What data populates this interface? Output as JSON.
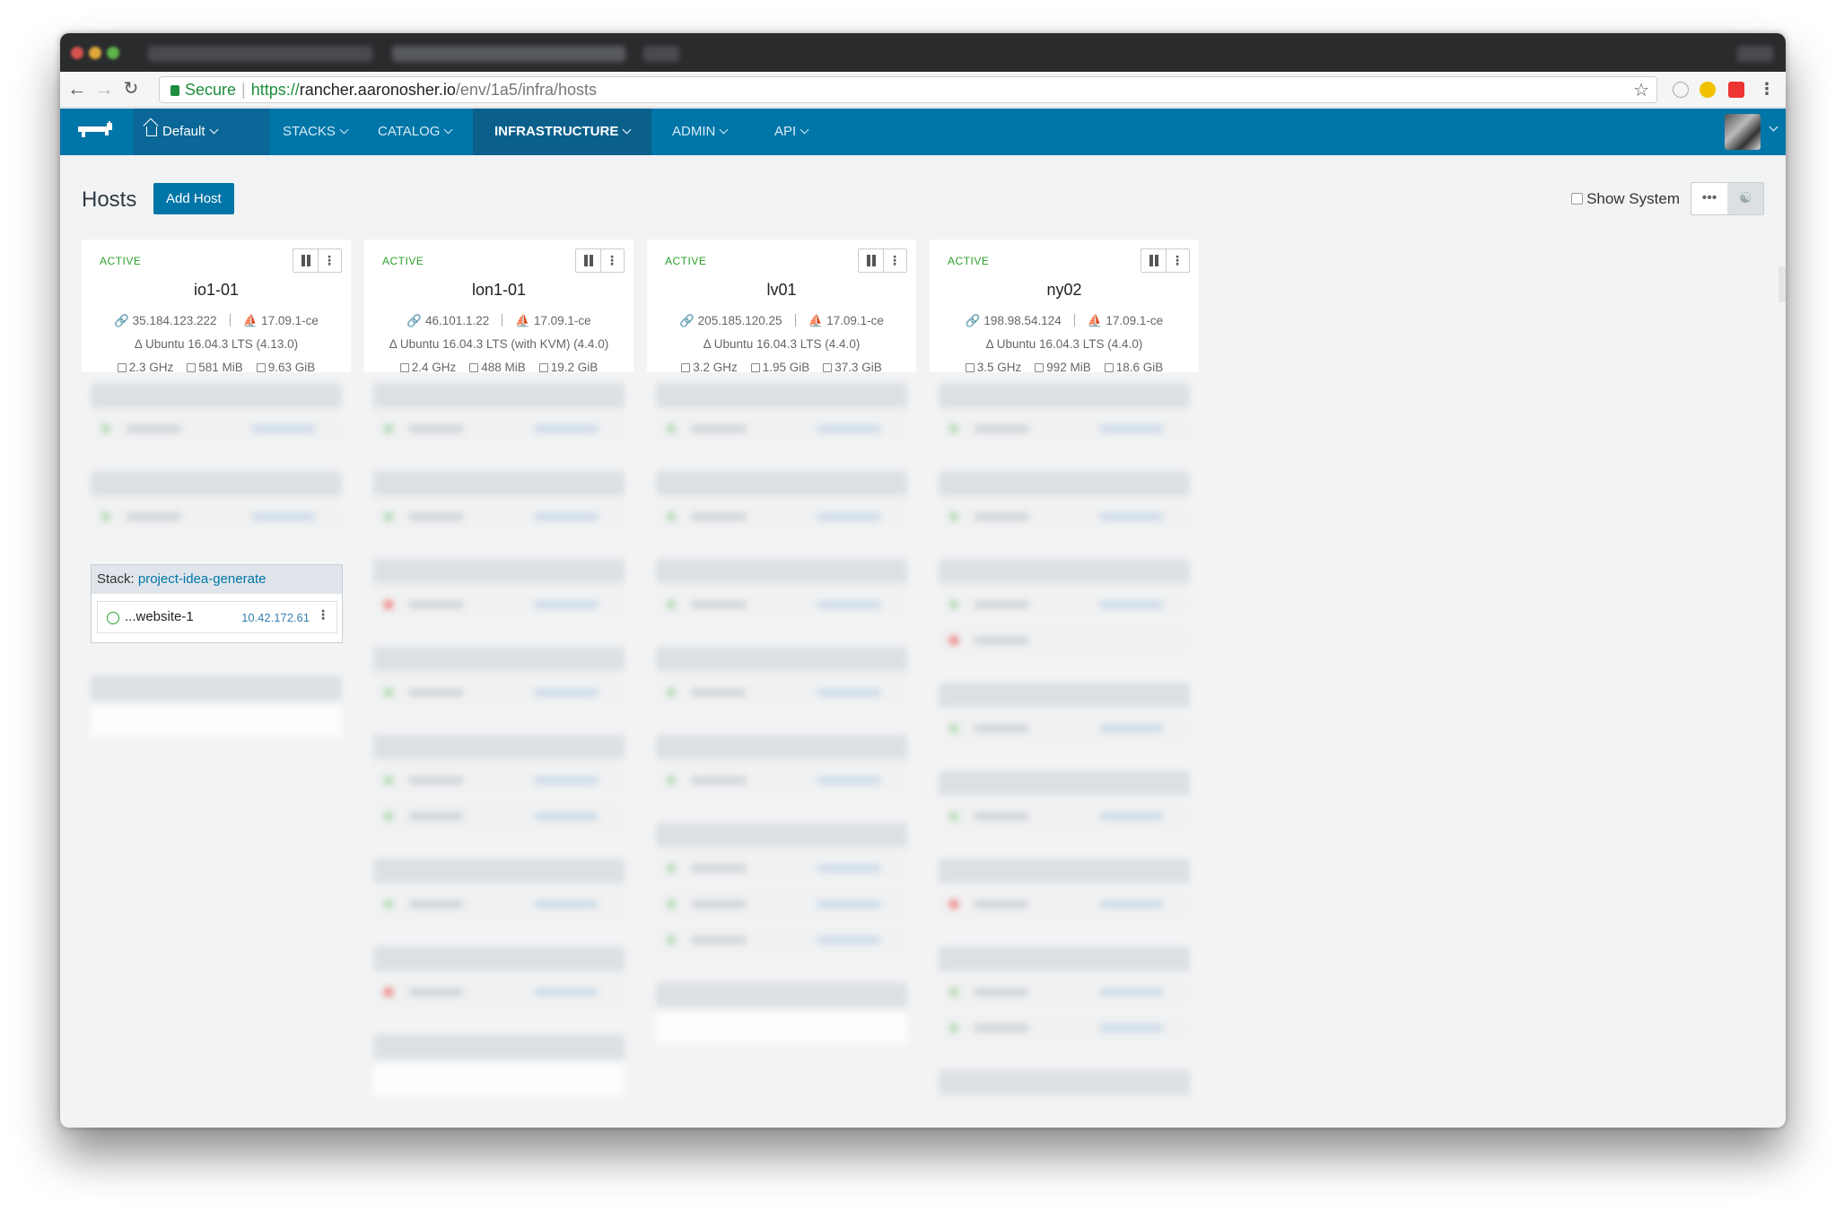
{
  "browser": {
    "secure_label": "Secure",
    "url_scheme": "https://",
    "url_host": "rancher.aaronosher.io",
    "url_path": "/env/1a5/infra/hosts"
  },
  "nav": {
    "env_label": "Default",
    "items": [
      "STACKS",
      "CATALOG",
      "INFRASTRUCTURE",
      "ADMIN",
      "API"
    ]
  },
  "page": {
    "title": "Hosts",
    "add_host": "Add Host",
    "show_system": "Show System",
    "more_glyph": "•••"
  },
  "hosts": [
    {
      "state": "ACTIVE",
      "name": "io1-01",
      "ip": "35.184.123.222",
      "docker": "17.09.1-ce",
      "os": "Ubuntu 16.04.3 LTS (4.13.0)",
      "cpu": "2.3 GHz",
      "mem": "581 MiB",
      "disk": "9.63 GiB"
    },
    {
      "state": "ACTIVE",
      "name": "lon1-01",
      "ip": "46.101.1.22",
      "docker": "17.09.1-ce",
      "os": "Ubuntu 16.04.3 LTS (with KVM) (4.4.0)",
      "cpu": "2.4 GHz",
      "mem": "488 MiB",
      "disk": "19.2 GiB"
    },
    {
      "state": "ACTIVE",
      "name": "lv01",
      "ip": "205.185.120.25",
      "docker": "17.09.1-ce",
      "os": "Ubuntu 16.04.3 LTS (4.4.0)",
      "cpu": "3.2 GHz",
      "mem": "1.95 GiB",
      "disk": "37.3 GiB"
    },
    {
      "state": "ACTIVE",
      "name": "ny02",
      "ip": "198.98.54.124",
      "docker": "17.09.1-ce",
      "os": "Ubuntu 16.04.3 LTS (4.4.0)",
      "cpu": "3.5 GHz",
      "mem": "992 MiB",
      "disk": "18.6 GiB"
    }
  ],
  "focused_stack": {
    "prefix": "Stack: ",
    "name": "project-idea-generate",
    "container_name": "...website-1",
    "container_ip": "10.42.172.61"
  }
}
